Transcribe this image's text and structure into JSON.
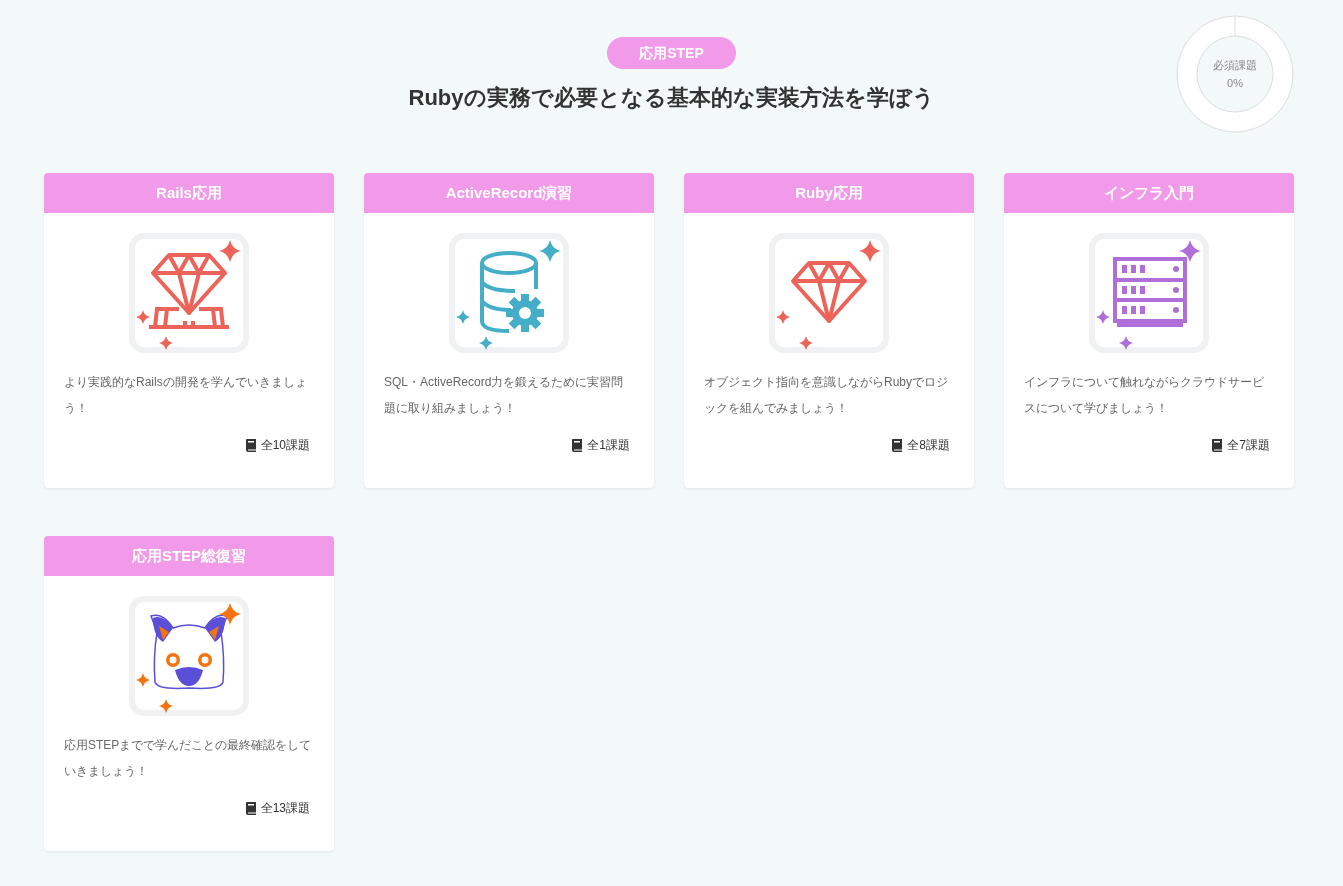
{
  "header": {
    "badge": "応用STEP",
    "title": "Rubyの実務で必要となる基本的な実装方法を学ぼう"
  },
  "progress": {
    "label": "必須課題",
    "reading": "0%",
    "level": 0
  },
  "cards": [
    {
      "title": "Rails応用",
      "kind": "gem-stand",
      "color": "#ec6459",
      "description": "より実践的なRailsの開発を学んでいきましょう！",
      "count": "全10課題"
    },
    {
      "title": "ActiveRecord演習",
      "kind": "database-gear",
      "color": "#44adc8",
      "description": "SQL・ActiveRecord力を鍛えるために実習問題に取り組みましょう！",
      "count": "全1課題"
    },
    {
      "title": "Ruby応用",
      "kind": "gem",
      "color": "#ec6459",
      "description": "オブジェクト指向を意識しながらRubyでロジックを組んでみましょう！",
      "count": "全8課題"
    },
    {
      "title": "インフラ入門",
      "kind": "server",
      "color": "#b06ed8",
      "description": "インフラについて触れながらクラウドサービスについて学びましょう！",
      "count": "全7課題"
    },
    {
      "title": "応用STEP総復習",
      "kind": "mascot",
      "color": "#f57311",
      "description": "応用STEPまでで学んだことの最終確認をしていきましょう！",
      "count": "全13課題"
    }
  ]
}
